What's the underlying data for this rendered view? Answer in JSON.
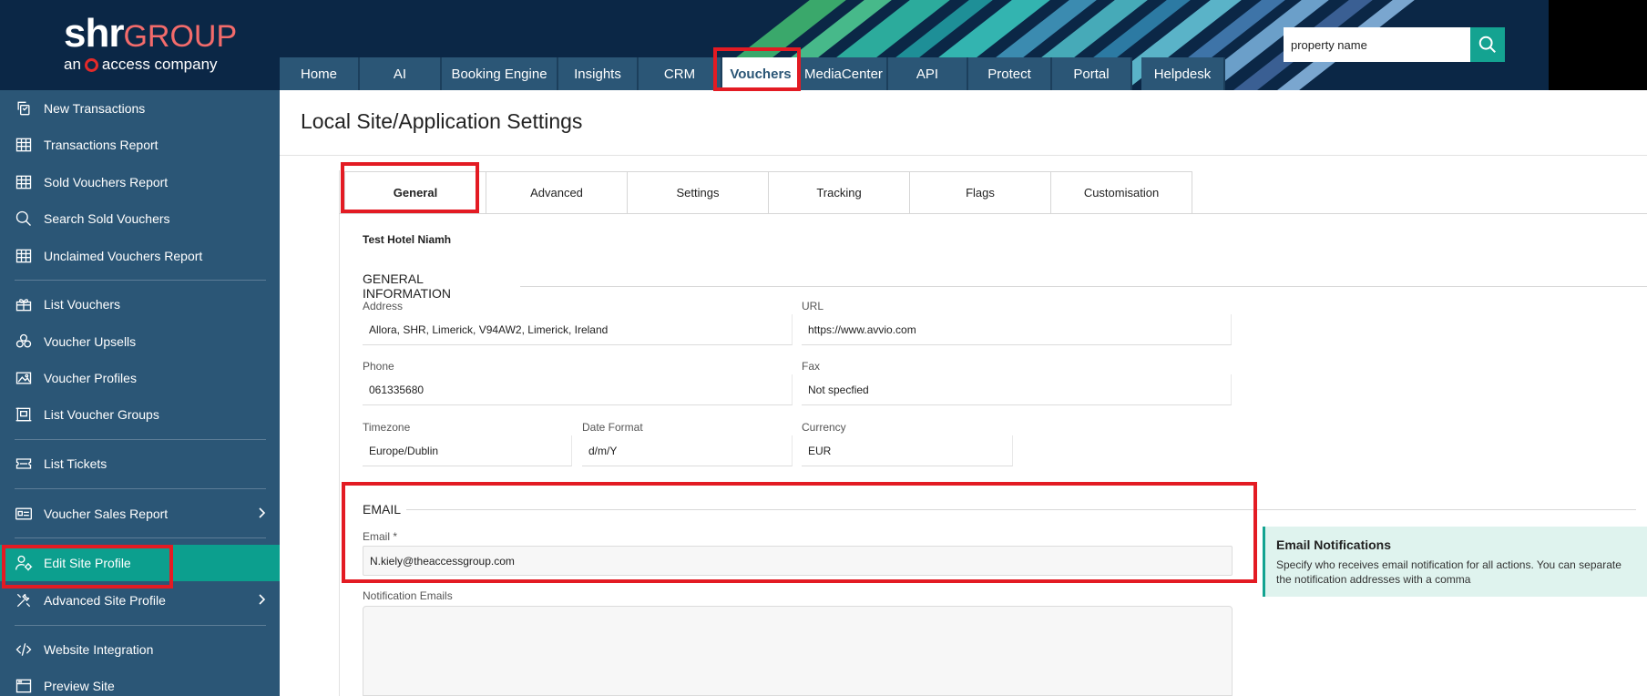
{
  "header": {
    "logo": {
      "brand_main": "shr",
      "brand_sub": "GROUP",
      "tagline_prefix": "an",
      "tagline_suffix": "access company"
    },
    "search": {
      "value": "property name",
      "placeholder": "property name",
      "icon": "search-icon"
    },
    "nav": [
      {
        "label": "Home",
        "width": 88
      },
      {
        "label": "AI",
        "width": 90
      },
      {
        "label": "Booking Engine",
        "width": 128
      },
      {
        "label": "Insights",
        "width": 88
      },
      {
        "label": "CRM",
        "width": 92
      },
      {
        "label": "Vouchers",
        "width": 86
      },
      {
        "label": "MediaCenter",
        "width": 96
      },
      {
        "label": "API",
        "width": 88
      },
      {
        "label": "Protect",
        "width": 92
      },
      {
        "label": "Portal",
        "width": 88
      },
      {
        "label": "Helpdesk",
        "width": 92
      }
    ],
    "nav_active": "Vouchers"
  },
  "sidebar": {
    "items": [
      {
        "label": "New Transactions",
        "icon": "transaction-icon"
      },
      {
        "label": "Transactions Report",
        "icon": "table-icon"
      },
      {
        "label": "Sold Vouchers Report",
        "icon": "table-icon"
      },
      {
        "label": "Search Sold Vouchers",
        "icon": "search-icon"
      },
      {
        "label": "Unclaimed Vouchers Report",
        "icon": "table-icon"
      },
      {
        "label": "List Vouchers",
        "icon": "gift-icon"
      },
      {
        "label": "Voucher Upsells",
        "icon": "coins-icon"
      },
      {
        "label": "Voucher Profiles",
        "icon": "image-icon"
      },
      {
        "label": "List Voucher Groups",
        "icon": "group-icon"
      },
      {
        "label": "List Tickets",
        "icon": "ticket-icon"
      },
      {
        "label": "Voucher Sales Report",
        "icon": "id-card-icon"
      },
      {
        "label": "Edit Site Profile",
        "icon": "user-gear-icon"
      },
      {
        "label": "Advanced Site Profile",
        "icon": "tools-icon"
      },
      {
        "label": "Website Integration",
        "icon": "code-icon"
      },
      {
        "label": "Preview Site",
        "icon": "browser-icon"
      }
    ],
    "active": "Edit Site Profile"
  },
  "main": {
    "title": "Local Site/Application Settings",
    "tabs": [
      "General",
      "Advanced",
      "Settings",
      "Tracking",
      "Flags",
      "Customisation"
    ],
    "active_tab": "General",
    "hotel_name": "Test Hotel Niamh",
    "general_info": {
      "heading": "GENERAL INFORMATION",
      "address_label": "Address",
      "address_value": "Allora, SHR, Limerick, V94AW2, Limerick, Ireland",
      "url_label": "URL",
      "url_value": "https://www.avvio.com",
      "phone_label": "Phone",
      "phone_value": "061335680",
      "fax_label": "Fax",
      "fax_value": "Not specfied",
      "timezone_label": "Timezone",
      "timezone_value": "Europe/Dublin",
      "date_format_label": "Date Format",
      "date_format_value": "d/m/Y",
      "currency_label": "Currency",
      "currency_value": "EUR"
    },
    "email": {
      "heading": "EMAIL",
      "email_label": "Email *",
      "email_value": "N.kiely@theaccessgroup.com",
      "notification_label": "Notification Emails",
      "notification_value": ""
    },
    "info_box": {
      "title": "Email Notifications",
      "text": "Specify who receives email notification for all actions. You can separate the notification addresses with a comma"
    }
  },
  "colors": {
    "header_bg": "#0b2746",
    "nav_bg": "#2b5676",
    "sidebar_bg": "#2b5676",
    "accent": "#14a391",
    "active_sidebar": "#0c9f8e",
    "highlight": "#e31b23"
  }
}
